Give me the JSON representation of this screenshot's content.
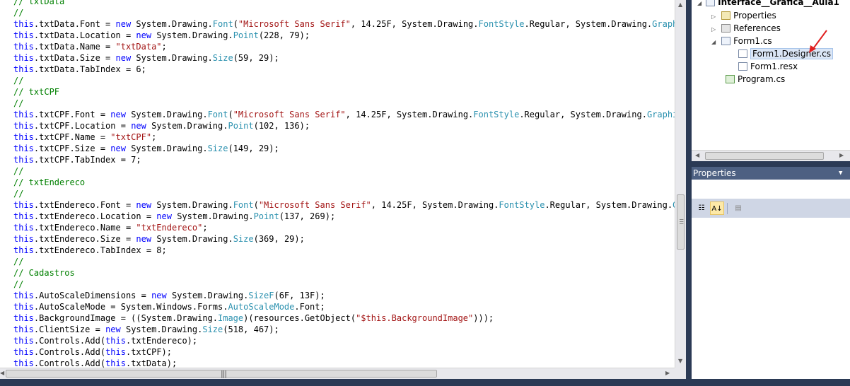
{
  "editor": {
    "lines": [
      [
        [
          "cm",
          "// txtData"
        ]
      ],
      [
        [
          "cm",
          "//"
        ]
      ],
      [
        [
          "kw",
          "this"
        ],
        [
          "p",
          ".txtData.Font = "
        ],
        [
          "kw",
          "new"
        ],
        [
          "p",
          " System.Drawing."
        ],
        [
          "ty",
          "Font"
        ],
        [
          "p",
          "("
        ],
        [
          "st",
          "\"Microsoft Sans Serif\""
        ],
        [
          "p",
          ", 14.25F, System.Drawing."
        ],
        [
          "ty",
          "FontStyle"
        ],
        [
          "p",
          ".Regular, System.Drawing."
        ],
        [
          "ty",
          "GraphicsU"
        ]
      ],
      [
        [
          "kw",
          "this"
        ],
        [
          "p",
          ".txtData.Location = "
        ],
        [
          "kw",
          "new"
        ],
        [
          "p",
          " System.Drawing."
        ],
        [
          "ty",
          "Point"
        ],
        [
          "p",
          "(228, 79);"
        ]
      ],
      [
        [
          "kw",
          "this"
        ],
        [
          "p",
          ".txtData.Name = "
        ],
        [
          "st",
          "\"txtData\""
        ],
        [
          "p",
          ";"
        ]
      ],
      [
        [
          "kw",
          "this"
        ],
        [
          "p",
          ".txtData.Size = "
        ],
        [
          "kw",
          "new"
        ],
        [
          "p",
          " System.Drawing."
        ],
        [
          "ty",
          "Size"
        ],
        [
          "p",
          "(59, 29);"
        ]
      ],
      [
        [
          "kw",
          "this"
        ],
        [
          "p",
          ".txtData.TabIndex = 6;"
        ]
      ],
      [
        [
          "cm",
          "//"
        ]
      ],
      [
        [
          "cm",
          "// txtCPF"
        ]
      ],
      [
        [
          "cm",
          "//"
        ]
      ],
      [
        [
          "kw",
          "this"
        ],
        [
          "p",
          ".txtCPF.Font = "
        ],
        [
          "kw",
          "new"
        ],
        [
          "p",
          " System.Drawing."
        ],
        [
          "ty",
          "Font"
        ],
        [
          "p",
          "("
        ],
        [
          "st",
          "\"Microsoft Sans Serif\""
        ],
        [
          "p",
          ", 14.25F, System.Drawing."
        ],
        [
          "ty",
          "FontStyle"
        ],
        [
          "p",
          ".Regular, System.Drawing."
        ],
        [
          "ty",
          "GraphicsUn"
        ]
      ],
      [
        [
          "kw",
          "this"
        ],
        [
          "p",
          ".txtCPF.Location = "
        ],
        [
          "kw",
          "new"
        ],
        [
          "p",
          " System.Drawing."
        ],
        [
          "ty",
          "Point"
        ],
        [
          "p",
          "(102, 136);"
        ]
      ],
      [
        [
          "kw",
          "this"
        ],
        [
          "p",
          ".txtCPF.Name = "
        ],
        [
          "st",
          "\"txtCPF\""
        ],
        [
          "p",
          ";"
        ]
      ],
      [
        [
          "kw",
          "this"
        ],
        [
          "p",
          ".txtCPF.Size = "
        ],
        [
          "kw",
          "new"
        ],
        [
          "p",
          " System.Drawing."
        ],
        [
          "ty",
          "Size"
        ],
        [
          "p",
          "(149, 29);"
        ]
      ],
      [
        [
          "kw",
          "this"
        ],
        [
          "p",
          ".txtCPF.TabIndex = 7;"
        ]
      ],
      [
        [
          "cm",
          "//"
        ]
      ],
      [
        [
          "cm",
          "// txtEndereco"
        ]
      ],
      [
        [
          "cm",
          "//"
        ]
      ],
      [
        [
          "kw",
          "this"
        ],
        [
          "p",
          ".txtEndereco.Font = "
        ],
        [
          "kw",
          "new"
        ],
        [
          "p",
          " System.Drawing."
        ],
        [
          "ty",
          "Font"
        ],
        [
          "p",
          "("
        ],
        [
          "st",
          "\"Microsoft Sans Serif\""
        ],
        [
          "p",
          ", 14.25F, System.Drawing."
        ],
        [
          "ty",
          "FontStyle"
        ],
        [
          "p",
          ".Regular, System.Drawing."
        ],
        [
          "ty",
          "Graph"
        ]
      ],
      [
        [
          "kw",
          "this"
        ],
        [
          "p",
          ".txtEndereco.Location = "
        ],
        [
          "kw",
          "new"
        ],
        [
          "p",
          " System.Drawing."
        ],
        [
          "ty",
          "Point"
        ],
        [
          "p",
          "(137, 269);"
        ]
      ],
      [
        [
          "kw",
          "this"
        ],
        [
          "p",
          ".txtEndereco.Name = "
        ],
        [
          "st",
          "\"txtEndereco\""
        ],
        [
          "p",
          ";"
        ]
      ],
      [
        [
          "kw",
          "this"
        ],
        [
          "p",
          ".txtEndereco.Size = "
        ],
        [
          "kw",
          "new"
        ],
        [
          "p",
          " System.Drawing."
        ],
        [
          "ty",
          "Size"
        ],
        [
          "p",
          "(369, 29);"
        ]
      ],
      [
        [
          "kw",
          "this"
        ],
        [
          "p",
          ".txtEndereco.TabIndex = 8;"
        ]
      ],
      [
        [
          "cm",
          "//"
        ]
      ],
      [
        [
          "cm",
          "// Cadastros"
        ]
      ],
      [
        [
          "cm",
          "//"
        ]
      ],
      [
        [
          "kw",
          "this"
        ],
        [
          "p",
          ".AutoScaleDimensions = "
        ],
        [
          "kw",
          "new"
        ],
        [
          "p",
          " System.Drawing."
        ],
        [
          "ty",
          "SizeF"
        ],
        [
          "p",
          "(6F, 13F);"
        ]
      ],
      [
        [
          "kw",
          "this"
        ],
        [
          "p",
          ".AutoScaleMode = System.Windows.Forms."
        ],
        [
          "ty",
          "AutoScaleMode"
        ],
        [
          "p",
          ".Font;"
        ]
      ],
      [
        [
          "kw",
          "this"
        ],
        [
          "p",
          ".BackgroundImage = ((System.Drawing."
        ],
        [
          "ty",
          "Image"
        ],
        [
          "p",
          ")(resources.GetObject("
        ],
        [
          "st",
          "\"$this.BackgroundImage\""
        ],
        [
          "p",
          ")));"
        ]
      ],
      [
        [
          "kw",
          "this"
        ],
        [
          "p",
          ".ClientSize = "
        ],
        [
          "kw",
          "new"
        ],
        [
          "p",
          " System.Drawing."
        ],
        [
          "ty",
          "Size"
        ],
        [
          "p",
          "(518, 467);"
        ]
      ],
      [
        [
          "kw",
          "this"
        ],
        [
          "p",
          ".Controls.Add("
        ],
        [
          "kw",
          "this"
        ],
        [
          "p",
          ".txtEndereco);"
        ]
      ],
      [
        [
          "kw",
          "this"
        ],
        [
          "p",
          ".Controls.Add("
        ],
        [
          "kw",
          "this"
        ],
        [
          "p",
          ".txtCPF);"
        ]
      ],
      [
        [
          "kw",
          "this"
        ],
        [
          "p",
          ".Controls.Add("
        ],
        [
          "kw",
          "this"
        ],
        [
          "p",
          ".txtData);"
        ]
      ]
    ]
  },
  "solution_explorer": {
    "project": "Interface__Grafica__Aula1",
    "items": {
      "properties": "Properties",
      "references": "References",
      "form1": "Form1.cs",
      "designer": "Form1.Designer.cs",
      "resx": "Form1.resx",
      "program": "Program.cs"
    }
  },
  "properties_panel": {
    "title": "Properties"
  },
  "colors": {
    "keyword": "#0000ff",
    "comment": "#008000",
    "type": "#2b91af",
    "string": "#a31515",
    "panel_header": "#4d6082",
    "annotation_arrow": "#e02020"
  },
  "icons": [
    "expand-triangle-icon",
    "collapse-triangle-icon",
    "properties-folder-icon",
    "references-icon",
    "form-icon",
    "cs-file-icon",
    "resx-file-icon",
    "categorized-icon",
    "alphabetical-icon",
    "property-pages-icon"
  ]
}
